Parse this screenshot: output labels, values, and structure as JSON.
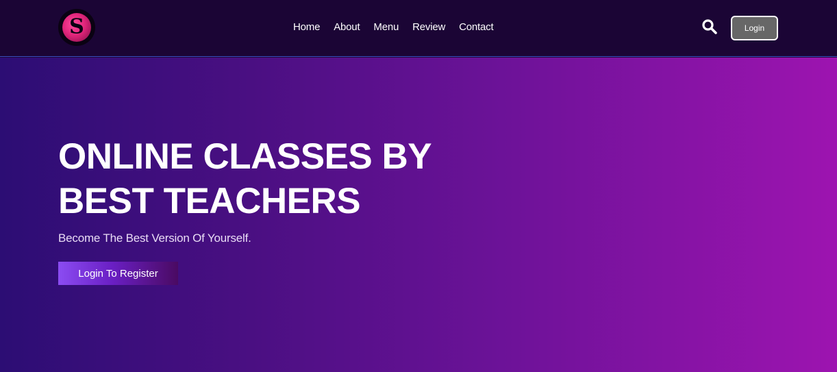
{
  "header": {
    "nav": [
      "Home",
      "About",
      "Menu",
      "Review",
      "Contact"
    ],
    "search_icon": "search-icon",
    "login_label": "Login"
  },
  "hero": {
    "title_line1": "ONLINE CLASSES BY",
    "title_line2": "BEST TEACHERS",
    "subtitle": "Become The Best Version Of Yourself.",
    "cta_label": "Login To Register"
  },
  "colors": {
    "header_bg": "#1b0535",
    "hero_gradient_start": "#2c0d74",
    "hero_gradient_end": "#9d14b0",
    "login_button_bg": "#676767",
    "cta_gradient_start": "#8b4cf2",
    "logo_pink": "#e0257a"
  }
}
